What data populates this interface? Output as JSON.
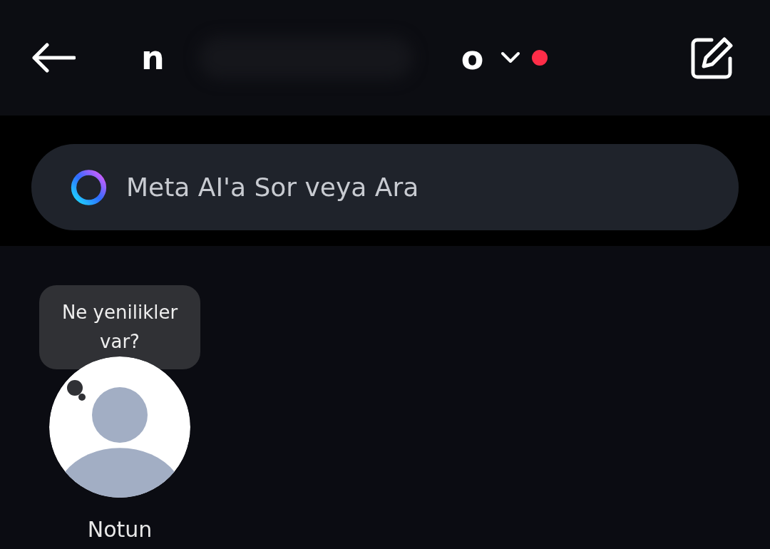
{
  "header": {
    "title_start": "n",
    "title_end": "o",
    "has_unread": true
  },
  "search": {
    "placeholder": "Meta AI'a Sor veya Ara"
  },
  "note": {
    "bubble": "Ne yenilikler var?",
    "label": "Notun"
  }
}
